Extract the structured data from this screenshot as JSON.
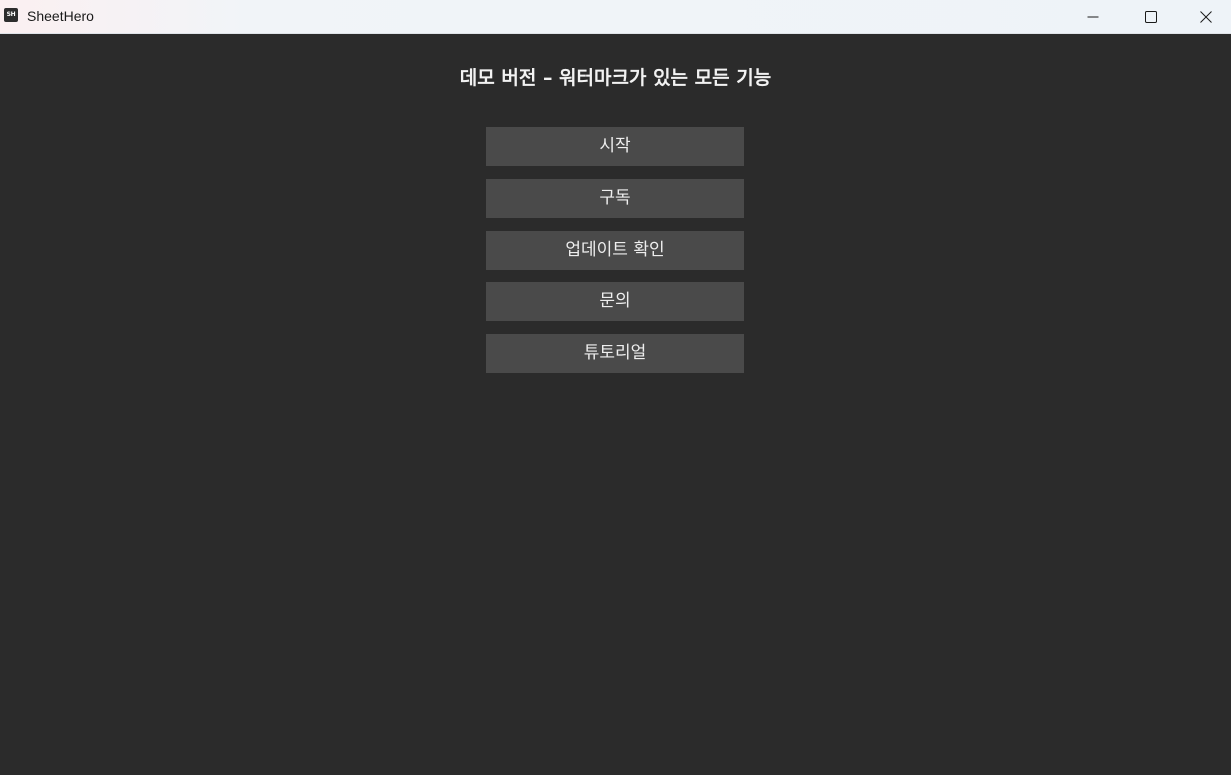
{
  "window": {
    "title": "SheetHero",
    "icon_text": "SH",
    "icon_name": "sheethero-app-icon",
    "controls": {
      "minimize_icon": "minimize-icon",
      "maximize_icon": "maximize-icon",
      "close_icon": "close-icon"
    }
  },
  "main": {
    "heading": "데모 버전 – 워터마크가 있는 모든 기능",
    "buttons": [
      {
        "label": "시작"
      },
      {
        "label": "구독"
      },
      {
        "label": "업데이트 확인"
      },
      {
        "label": "문의"
      },
      {
        "label": "튜토리얼"
      }
    ]
  },
  "colors": {
    "background": "#2b2b2b",
    "button": "#4a4a4a",
    "text": "#eeeeee"
  }
}
